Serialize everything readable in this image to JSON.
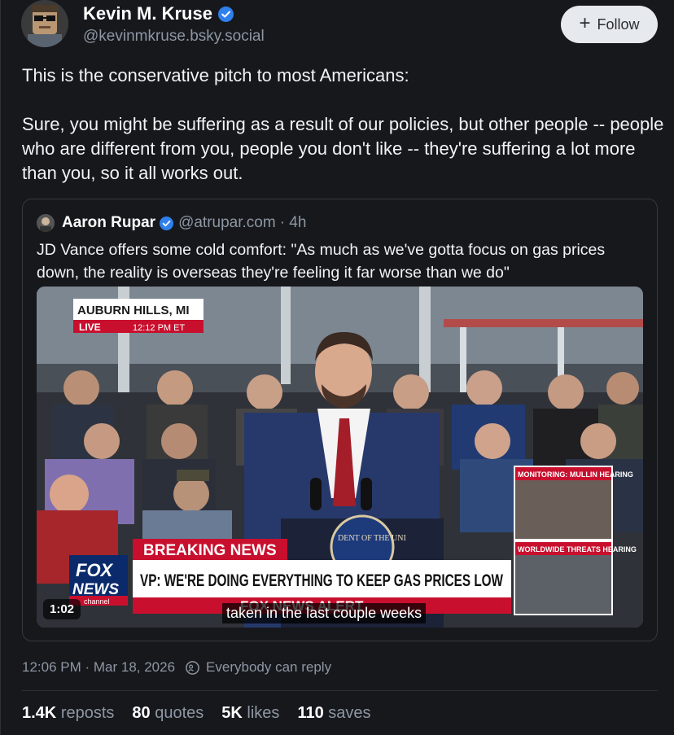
{
  "author": {
    "name": "Kevin M. Kruse",
    "handle": "@kevinmkruse.bsky.social",
    "follow_label": "Follow"
  },
  "post": {
    "paragraph1": "This is the conservative pitch to most Americans:",
    "paragraph2": "Sure, you might be suffering as a result of our policies, but other people -- people who are different from you, people you don't like -- they're suffering a lot more than you, so it all works out."
  },
  "quote": {
    "name": "Aaron Rupar",
    "handle": "@atrupar.com",
    "time": "· 4h",
    "text": "JD Vance offers some cold comfort: \"As much as we've gotta focus on gas prices down, the reality is overseas they're feeling it far worse than we do\"",
    "video": {
      "location": "AUBURN HILLS, MI",
      "live": "LIVE",
      "live_time": "12:12 PM ET",
      "breaking": "BREAKING NEWS",
      "headline": "VP: WE'RE DOING EVERYTHING TO KEEP GAS PRICES LOW",
      "alert": "FOX NEWS ALERT",
      "network_top": "FOX",
      "network_bottom": "NEWS",
      "network_sub": "channel",
      "box1": "MONITORING: MULLIN HEARING",
      "box2": "WORLDWIDE THREATS HEARING",
      "seal": "DENT OF THE UNI",
      "duration": "1:02",
      "caption": "taken in the last couple weeks"
    }
  },
  "meta": {
    "timestamp": "12:06 PM · Mar 18, 2026",
    "reply_setting": "Everybody can reply"
  },
  "stats": {
    "reposts_count": "1.4K",
    "reposts_label": "reposts",
    "quotes_count": "80",
    "quotes_label": "quotes",
    "likes_count": "5K",
    "likes_label": "likes",
    "saves_count": "110",
    "saves_label": "saves"
  },
  "colors": {
    "background": "#17181c",
    "verified": "#2f80ed",
    "fox_red": "#c8102e",
    "fox_blue": "#0a2a6b"
  }
}
